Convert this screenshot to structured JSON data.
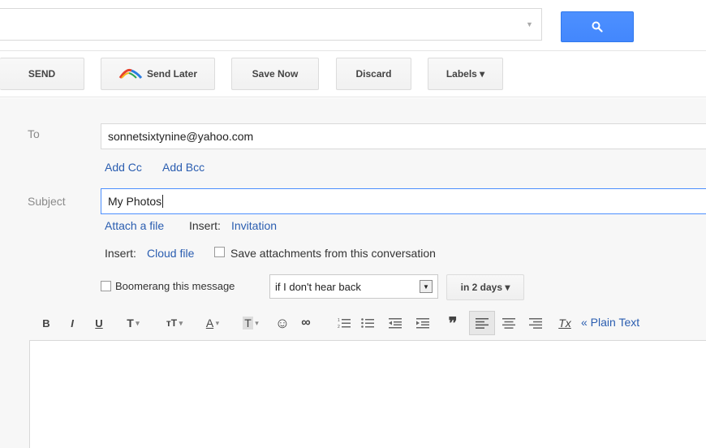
{
  "search": {
    "value": "",
    "icon": "search-icon",
    "accent": "#4d90fe"
  },
  "toolbar": {
    "send_label": "SEND",
    "send_later_label": "Send Later",
    "save_now_label": "Save Now",
    "discard_label": "Discard",
    "labels_label": "Labels ▾"
  },
  "compose": {
    "to_label": "To",
    "to_value": "sonnetsixtynine@yahoo.com",
    "add_cc": "Add Cc",
    "add_bcc": "Add Bcc",
    "subject_label": "Subject",
    "subject_value": "My Photos",
    "attach_file": "Attach a file",
    "insert_label_1": "Insert:",
    "invitation": "Invitation",
    "insert_label_2": "Insert:",
    "cloud_file": "Cloud file",
    "save_attachments": "Save attachments from this conversation",
    "boomerang_label": "Boomerang this message",
    "boomerang_condition": "if I don't hear back",
    "boomerang_days": "in 2 days ▾"
  },
  "format_toolbar": {
    "bold": "B",
    "italic": "I",
    "underline": "U",
    "font": "T",
    "size": "тT",
    "text_color": "A",
    "highlight": "T",
    "emoji": "☺",
    "link": "∞",
    "quote": "❞",
    "remove_format": "Tx",
    "plain_text": "« Plain Text"
  }
}
